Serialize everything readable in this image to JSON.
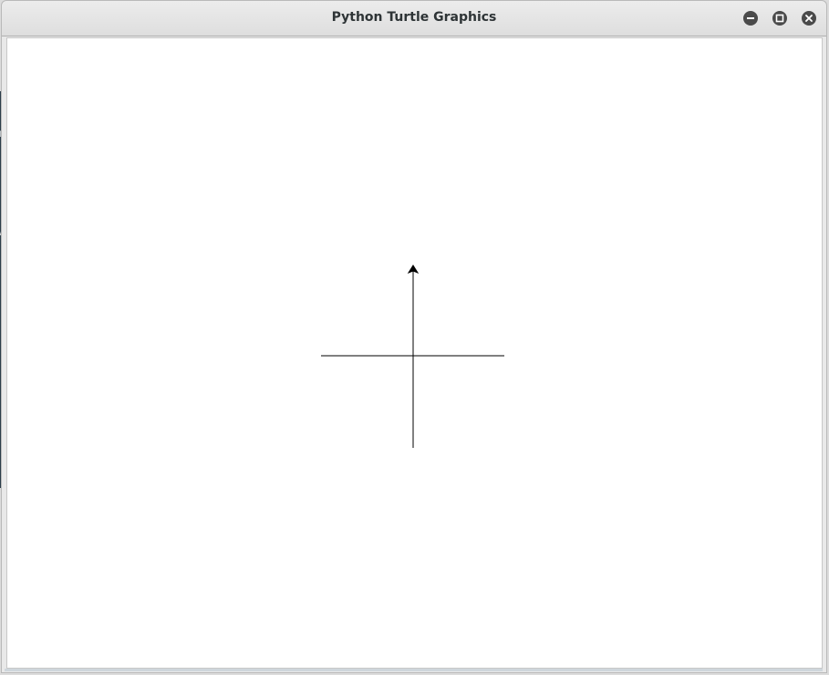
{
  "window": {
    "title": "Python Turtle Graphics"
  },
  "title_bar_buttons": {
    "minimize_icon": "minimize-icon",
    "maximize_icon": "maximize-icon",
    "close_icon": "close-icon"
  },
  "turtle_canvas": {
    "background_color": "#ffffff",
    "line_color": "#000000",
    "turtle_shape": "classic-arrow",
    "turtle_heading": "up"
  }
}
